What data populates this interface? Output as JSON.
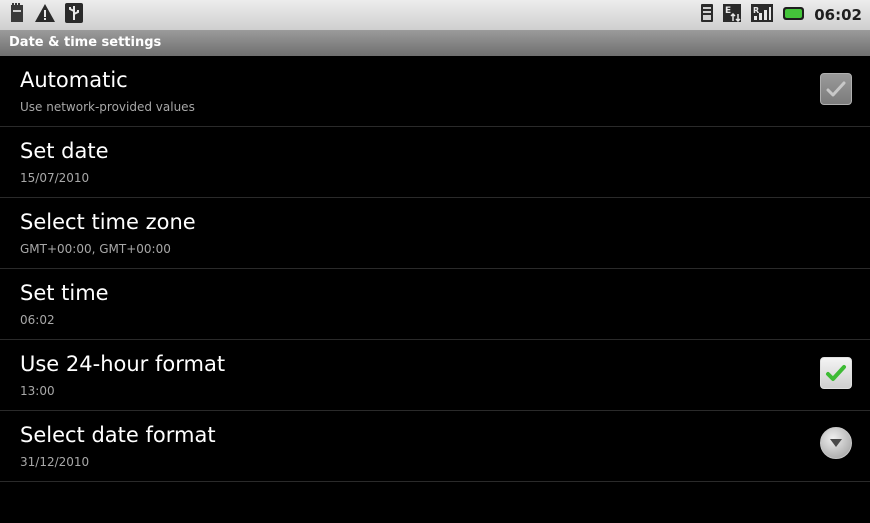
{
  "status_bar": {
    "left_icons": [
      "sd-card-icon",
      "warning-icon",
      "usb-icon"
    ],
    "right_icons": [
      "sim-icon",
      "data-signal-icon",
      "signal-icon",
      "battery-icon"
    ],
    "time": "06:02"
  },
  "screen": {
    "title": "Date & time settings"
  },
  "settings": [
    {
      "title": "Automatic",
      "subtitle": "Use network-provided values",
      "control": "checkbox",
      "checked": true,
      "enabled": false
    },
    {
      "title": "Set date",
      "subtitle": "15/07/2010",
      "control": "none"
    },
    {
      "title": "Select time zone",
      "subtitle": "GMT+00:00, GMT+00:00",
      "control": "none"
    },
    {
      "title": "Set time",
      "subtitle": "06:02",
      "control": "none"
    },
    {
      "title": "Use 24-hour format",
      "subtitle": "13:00",
      "control": "checkbox",
      "checked": true,
      "enabled": true
    },
    {
      "title": "Select date format",
      "subtitle": "31/12/2010",
      "control": "dropdown"
    }
  ],
  "colors": {
    "background": "#000000",
    "check_green": "#3dbb34",
    "subtitle_gray": "#a8a8a8"
  }
}
